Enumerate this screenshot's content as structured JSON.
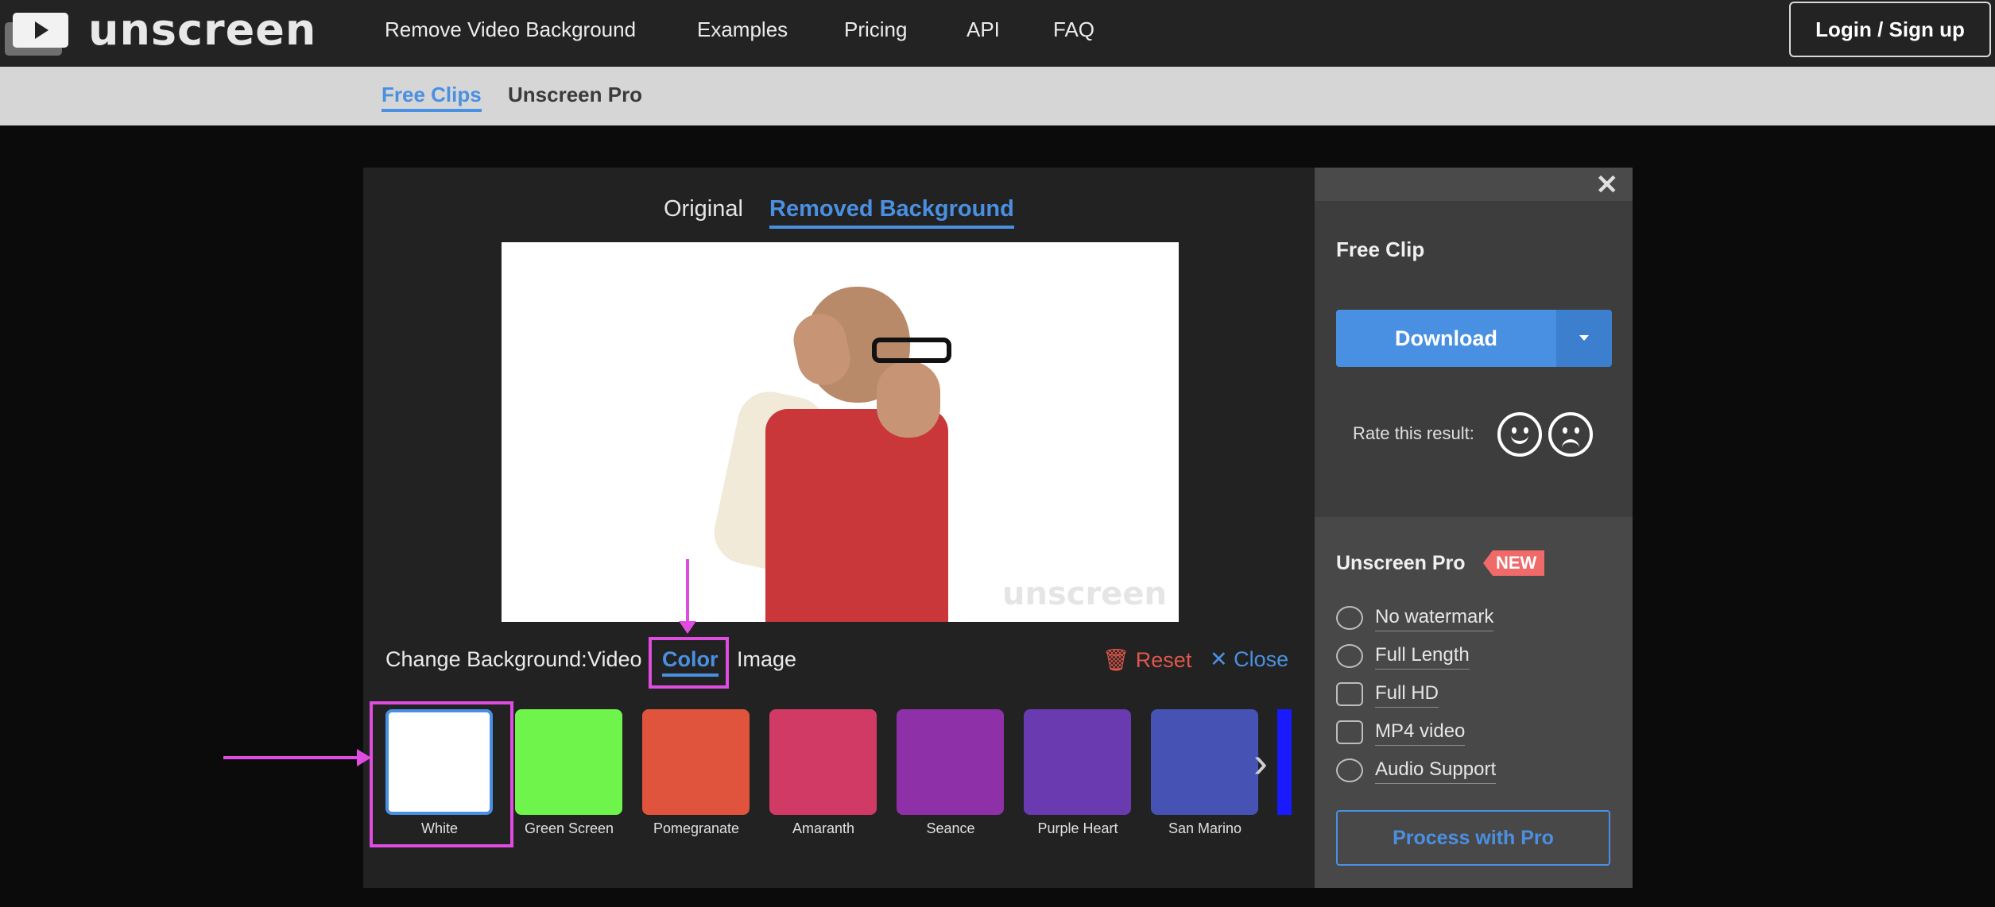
{
  "brand": {
    "name": "unscreen"
  },
  "nav": {
    "items": [
      "Remove Video Background",
      "Examples",
      "Pricing",
      "API",
      "FAQ"
    ],
    "login_label": "Login / Sign up"
  },
  "subnav": {
    "tabs": [
      "Free Clips",
      "Unscreen Pro"
    ],
    "active": "Free Clips"
  },
  "viewer": {
    "tabs": [
      "Original",
      "Removed Background"
    ],
    "active_tab": "Removed Background",
    "watermark": "unscreen"
  },
  "change_background": {
    "label": "Change Background:",
    "tabs": [
      "Video",
      "Color",
      "Image"
    ],
    "active_tab": "Color",
    "reset_label": "Reset",
    "close_label": "Close"
  },
  "swatches": [
    {
      "name": "White",
      "color": "#ffffff",
      "selected": true
    },
    {
      "name": "Green Screen",
      "color": "#6ef44a"
    },
    {
      "name": "Pomegranate",
      "color": "#e0533d"
    },
    {
      "name": "Amaranth",
      "color": "#d23a66"
    },
    {
      "name": "Seance",
      "color": "#8e31a8"
    },
    {
      "name": "Purple Heart",
      "color": "#6a3ab0"
    },
    {
      "name": "San Marino",
      "color": "#4653b5"
    }
  ],
  "side": {
    "title": "Free Clip",
    "download_label": "Download",
    "rate_label": "Rate this result:",
    "pro_title": "Unscreen Pro",
    "new_badge": "NEW",
    "features": [
      "No watermark",
      "Full Length",
      "Full HD",
      "MP4 video",
      "Audio Support"
    ],
    "pro_button": "Process with Pro"
  },
  "colors": {
    "accent": "#4a90e2",
    "annotation": "#e04ce0",
    "reset": "#e0574c"
  }
}
